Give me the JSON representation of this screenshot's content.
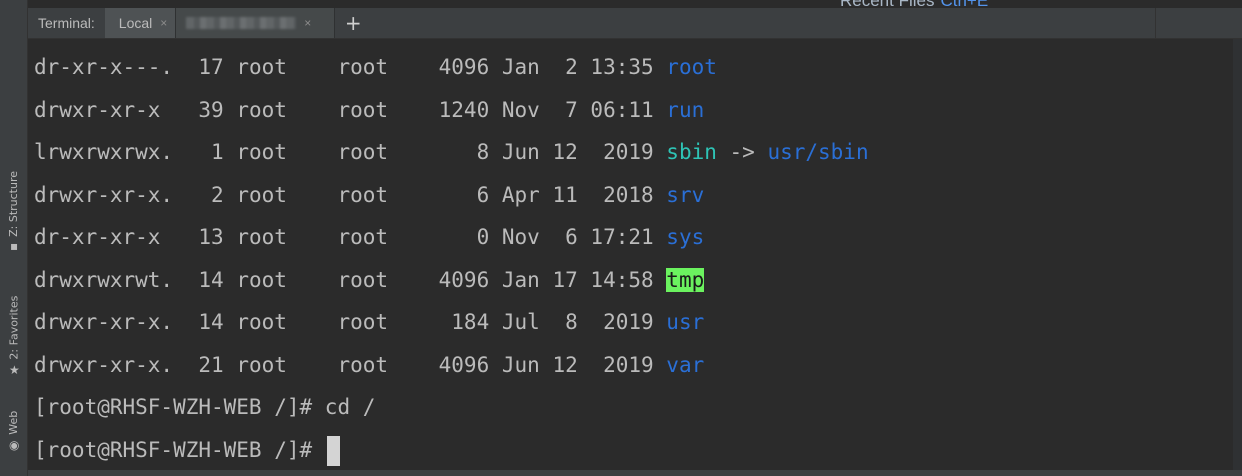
{
  "top": {
    "recent_files_label": "Recent Files",
    "recent_files_shortcut": "Ctrl+E"
  },
  "tabbar": {
    "title": "Terminal:",
    "tabs": [
      {
        "label": "Local",
        "close": "×"
      },
      {
        "label": "",
        "close": "×"
      }
    ],
    "add_label": "+"
  },
  "left_stripe": {
    "structure": "Z: Structure",
    "favorites": "2: Favorites",
    "web": "Web"
  },
  "colors": {
    "directory": "#2a6fd6",
    "symlink": "#2ec4b6",
    "sticky_dir_bg": "#6bf25f"
  },
  "listing": [
    {
      "perms": "dr-xr-x---.",
      "links": "17",
      "owner": "root",
      "group": "root",
      "size": "4096",
      "month": "Jan",
      "day": " 2",
      "time": "13:35",
      "name": "root",
      "kind": "dir"
    },
    {
      "perms": "drwxr-xr-x ",
      "links": "39",
      "owner": "root",
      "group": "root",
      "size": "1240",
      "month": "Nov",
      "day": " 7",
      "time": "06:11",
      "name": "run",
      "kind": "dir"
    },
    {
      "perms": "lrwxrwxrwx.",
      "links": " 1",
      "owner": "root",
      "group": "root",
      "size": "   8",
      "month": "Jun",
      "day": "12",
      "time": " 2019",
      "name": "sbin",
      "kind": "link",
      "arrow": " -> ",
      "target": "usr/sbin"
    },
    {
      "perms": "drwxr-xr-x.",
      "links": " 2",
      "owner": "root",
      "group": "root",
      "size": "   6",
      "month": "Apr",
      "day": "11",
      "time": " 2018",
      "name": "srv",
      "kind": "dir"
    },
    {
      "perms": "dr-xr-xr-x ",
      "links": "13",
      "owner": "root",
      "group": "root",
      "size": "   0",
      "month": "Nov",
      "day": " 6",
      "time": "17:21",
      "name": "sys",
      "kind": "dir"
    },
    {
      "perms": "drwxrwxrwt.",
      "links": "14",
      "owner": "root",
      "group": "root",
      "size": "4096",
      "month": "Jan",
      "day": "17",
      "time": "14:58",
      "name": "tmp",
      "kind": "sticky"
    },
    {
      "perms": "drwxr-xr-x.",
      "links": "14",
      "owner": "root",
      "group": "root",
      "size": " 184",
      "month": "Jul",
      "day": " 8",
      "time": " 2019",
      "name": "usr",
      "kind": "dir"
    },
    {
      "perms": "drwxr-xr-x.",
      "links": "21",
      "owner": "root",
      "group": "root",
      "size": "4096",
      "month": "Jun",
      "day": "12",
      "time": " 2019",
      "name": "var",
      "kind": "dir"
    }
  ],
  "prompts": [
    {
      "prompt": "[root@RHSF-WZH-WEB /]# ",
      "command": "cd /"
    },
    {
      "prompt": "[root@RHSF-WZH-WEB /]# ",
      "command": ""
    }
  ]
}
